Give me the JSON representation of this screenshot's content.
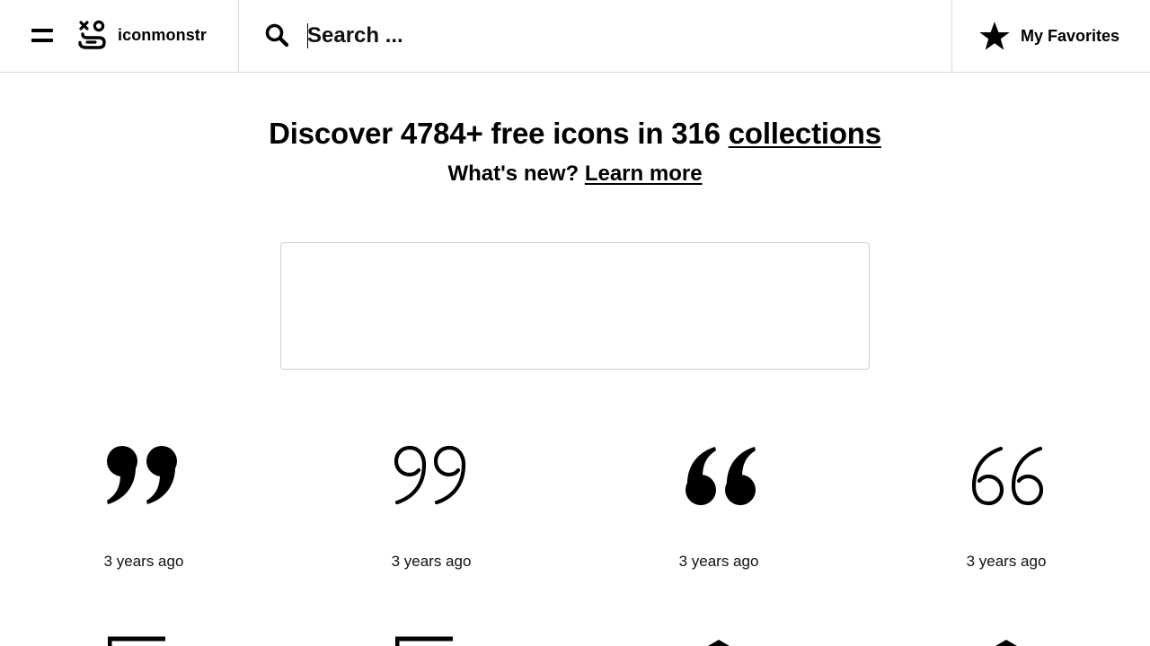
{
  "header": {
    "logo_text": "iconmonstr",
    "search_placeholder": "Search ...",
    "favorites_label": "My Favorites"
  },
  "hero": {
    "title_prefix": "Discover 4784+ free icons in 316 ",
    "title_link": "collections",
    "sub_prefix": "What's new? ",
    "sub_link": "Learn more"
  },
  "icons": [
    {
      "icon": "quote-right-filled-icon",
      "time": "3 years ago"
    },
    {
      "icon": "quote-right-outline-icon",
      "time": "3 years ago"
    },
    {
      "icon": "quote-left-filled-icon",
      "time": "3 years ago"
    },
    {
      "icon": "quote-left-outline-icon",
      "time": "3 years ago"
    }
  ]
}
